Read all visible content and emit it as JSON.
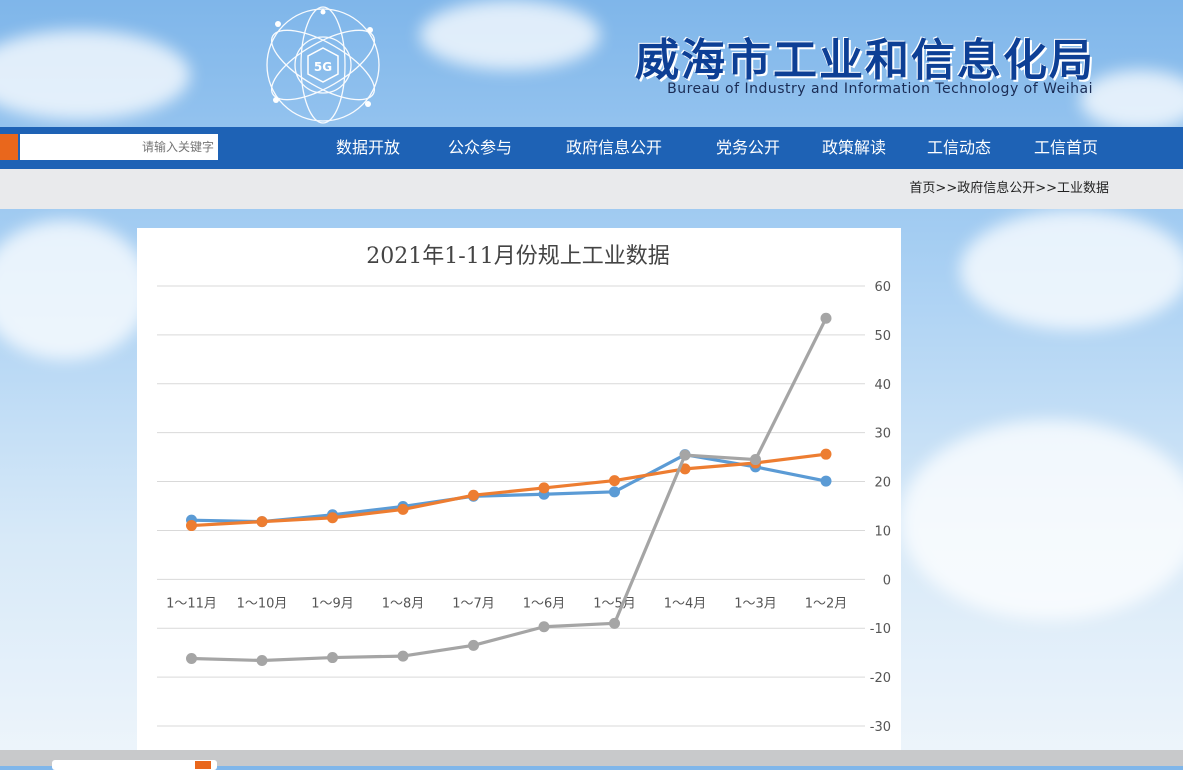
{
  "header": {
    "title": "威海市工业和信息化局",
    "subtitle": "Bureau of Industry and Information Technology of Weihai",
    "logo_badge": "5G"
  },
  "nav": {
    "items": [
      "工信首页",
      "工信动态",
      "政策解读",
      "党务公开",
      "政府信息公开",
      "公众参与",
      "数据开放"
    ],
    "search_placeholder": "请输入关键字"
  },
  "breadcrumb": "首页>>政府信息公开>>工业数据",
  "colors": {
    "nav": "#1e62b5",
    "accent": "#e9671c",
    "series_blue": "#5b9bd5",
    "series_orange": "#ed7d31",
    "series_gray": "#a5a5a5"
  },
  "chart_data": {
    "type": "line",
    "title": "2021年1-11月份规上工业数据",
    "categories": [
      "1～2月",
      "1～3月",
      "1～4月",
      "1～5月",
      "1～6月",
      "1～7月",
      "1～8月",
      "1～9月",
      "1～10月",
      "1～11月"
    ],
    "ylim": [
      -30,
      60
    ],
    "yticks": [
      60,
      50,
      40,
      30,
      20,
      10,
      0,
      -10,
      -20,
      -30
    ],
    "grid": true,
    "series": [
      {
        "color": "#5b9bd5",
        "values": [
          20.1,
          23.0,
          25.5,
          17.9,
          17.4,
          17.0,
          14.9,
          13.2,
          11.8,
          12.1
        ]
      },
      {
        "color": "#ed7d31",
        "values": [
          25.6,
          23.8,
          22.6,
          20.2,
          18.7,
          17.2,
          14.3,
          12.6,
          11.8,
          11.0
        ]
      },
      {
        "color": "#a5a5a5",
        "values": [
          53.4,
          24.5,
          25.4,
          -9.0,
          -9.7,
          -13.5,
          -15.7,
          -16.0,
          -16.6,
          -16.2
        ]
      }
    ]
  }
}
